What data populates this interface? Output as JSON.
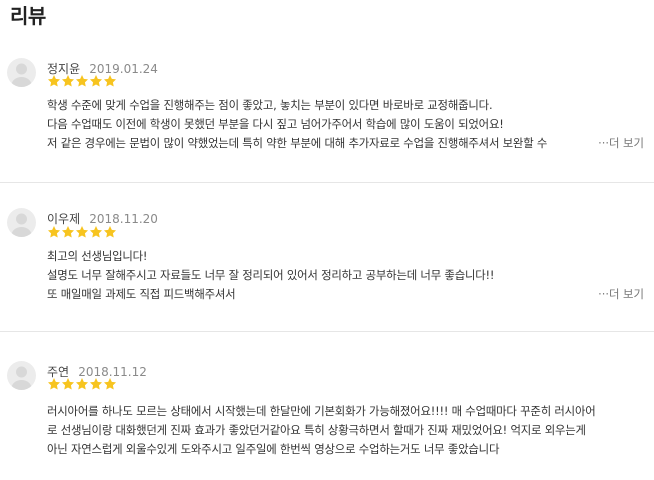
{
  "section": {
    "title": "리뷰"
  },
  "colors": {
    "star": "#f7c41f",
    "text": "#333333",
    "muted": "#8a8a8a"
  },
  "reviews": [
    {
      "name": "정지윤",
      "date": "2019.01.24",
      "rating": 5,
      "lines": [
        "학생 수준에 맞게 수업을 진행해주는 점이 좋았고, 놓치는 부분이 있다면 바로바로 교정해줍니다.",
        "다음 수업때도 이전에 학생이 못했던 부분을 다시 짚고 넘어가주어서 학습에 많이 도움이 되었어요!",
        "저 같은 경우에는 문법이 많이 약했었는데 특히 약한 부분에 대해 추가자료로 수업을 진행해주셔서 보완할 수"
      ],
      "more_label": "···더 보기"
    },
    {
      "name": "이우제",
      "date": "2018.11.20",
      "rating": 5,
      "lines": [
        "최고의 선생님입니다!",
        "설명도 너무 잘해주시고 자료들도 너무 잘 정리되어 있어서 정리하고 공부하는데 너무 좋습니다!!",
        "또 매일매일 과제도 직접 피드백해주셔서"
      ],
      "more_label": "···더 보기"
    },
    {
      "name": "주연",
      "date": "2018.11.12",
      "rating": 5,
      "lines": [
        "러시아어를 하나도 모르는 상태에서 시작했는데 한달만에 기본회화가 가능해졌어요!!!! 매 수업때마다 꾸준히 러시아어",
        "로 선생님이랑 대화했던게 진짜 효과가 좋았던거같아요 특히 상황극하면서 할때가 진짜 재밌었어요! 억지로 외우는게",
        "아닌 자연스럽게 외울수있게 도와주시고 일주일에 한번씩 영상으로 수업하는거도 너무 좋았습니다"
      ]
    }
  ]
}
